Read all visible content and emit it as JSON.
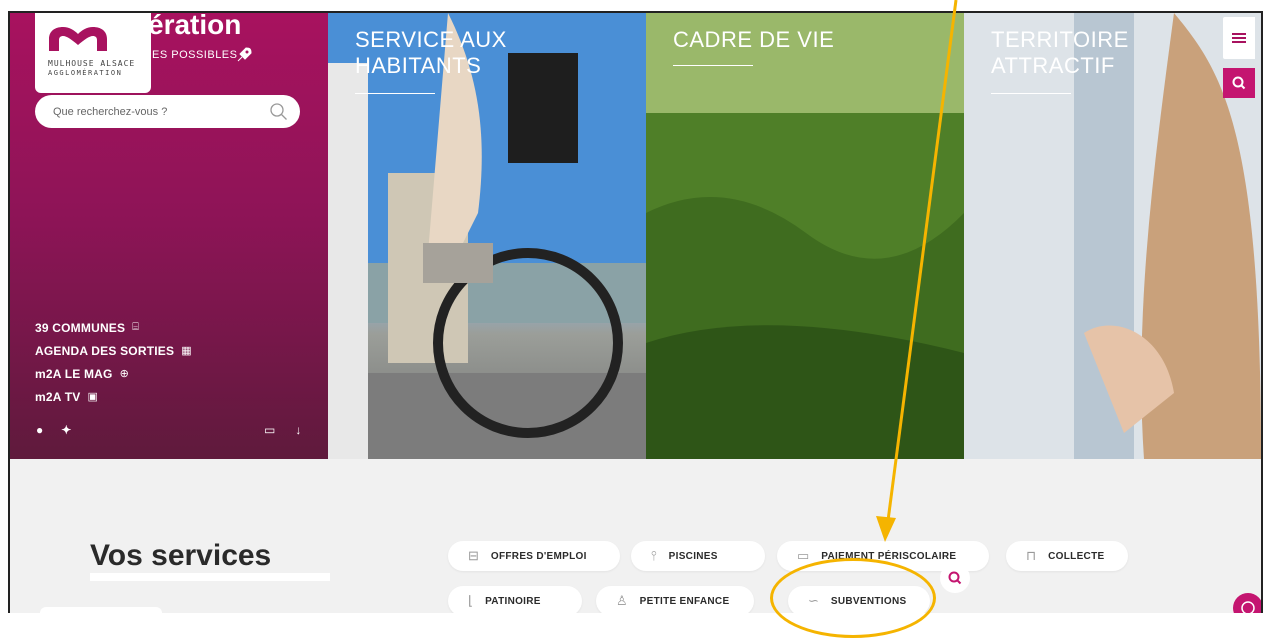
{
  "brand": {
    "logo_line1": "MULHOUSE ALSACE",
    "logo_line2": "AGGLOMÉRATION",
    "title_fragment": "ération",
    "tagline_fragment": "ES POSSIBLES"
  },
  "search": {
    "placeholder": "Que recherchez-vous ?"
  },
  "side_links": [
    {
      "label": "39 COMMUNES",
      "icon": "map-icon"
    },
    {
      "label": "AGENDA DES SORTIES",
      "icon": "calendar-icon"
    },
    {
      "label": "m2A LE MAG",
      "icon": "magazine-icon"
    },
    {
      "label": "m2A TV",
      "icon": "tv-icon"
    }
  ],
  "panels": [
    {
      "title_line1": "SERVICE AUX",
      "title_line2": "HABITANTS"
    },
    {
      "title_line1": "CADRE DE VIE",
      "title_line2": ""
    },
    {
      "title_line1": "TERRITOIRE",
      "title_line2": "ATTRACTIF"
    }
  ],
  "services": {
    "title": "Vos services",
    "items": [
      {
        "label": "OFFRES D'EMPLOI",
        "icon": "briefcase-icon"
      },
      {
        "label": "PISCINES",
        "icon": "pool-icon"
      },
      {
        "label": "PAIEMENT PÉRISCOLAIRE",
        "icon": "card-icon"
      },
      {
        "label": "COLLECTE",
        "icon": "trash-icon"
      },
      {
        "label": "PATINOIRE",
        "icon": "skate-icon"
      },
      {
        "label": "PETITE ENFANCE",
        "icon": "baby-icon"
      },
      {
        "label": "SUBVENTIONS",
        "icon": "grant-icon"
      }
    ]
  },
  "colors": {
    "brand": "#a8125f",
    "accent": "#c41570",
    "annotation": "#f5b400"
  }
}
